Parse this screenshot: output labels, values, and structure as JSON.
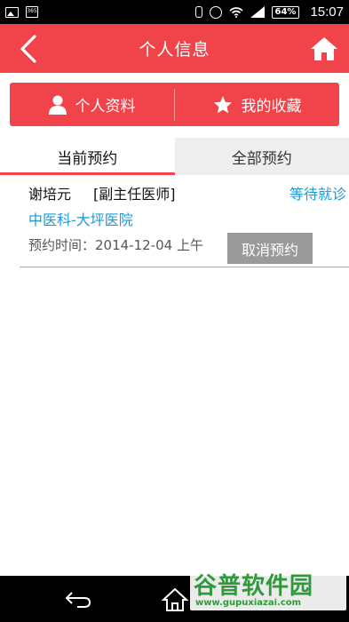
{
  "status_bar": {
    "calendar_text": "365",
    "battery": "64%",
    "time": "15:07",
    "icons": [
      "image-icon",
      "calendar-icon",
      "vibrate-icon",
      "alarm-icon",
      "wifi-icon",
      "signal-icon",
      "battery-icon"
    ]
  },
  "header": {
    "title": "个人信息",
    "back_icon": "chevron-left-icon",
    "home_icon": "home-icon"
  },
  "segments": [
    {
      "label": "个人资料",
      "icon": "person-icon"
    },
    {
      "label": "我的收藏",
      "icon": "star-icon"
    }
  ],
  "tabs": [
    {
      "label": "当前预约",
      "active": true
    },
    {
      "label": "全部预约",
      "active": false
    }
  ],
  "appointment": {
    "doctor_name": "谢培元",
    "doctor_title": "[副主任医师]",
    "status": "等待就诊",
    "hospital": "中医科-大坪医院",
    "time": "预约时间：2014-12-04 上午",
    "cancel_label": "取消预约"
  },
  "watermark": {
    "title": "谷普软件园",
    "url": "www.gupuxiazai.com"
  },
  "colors": {
    "accent": "#f0444a",
    "link": "#1a9ad8",
    "cancel_button": "#9a9a9a",
    "watermark": "#2f9a3b"
  }
}
